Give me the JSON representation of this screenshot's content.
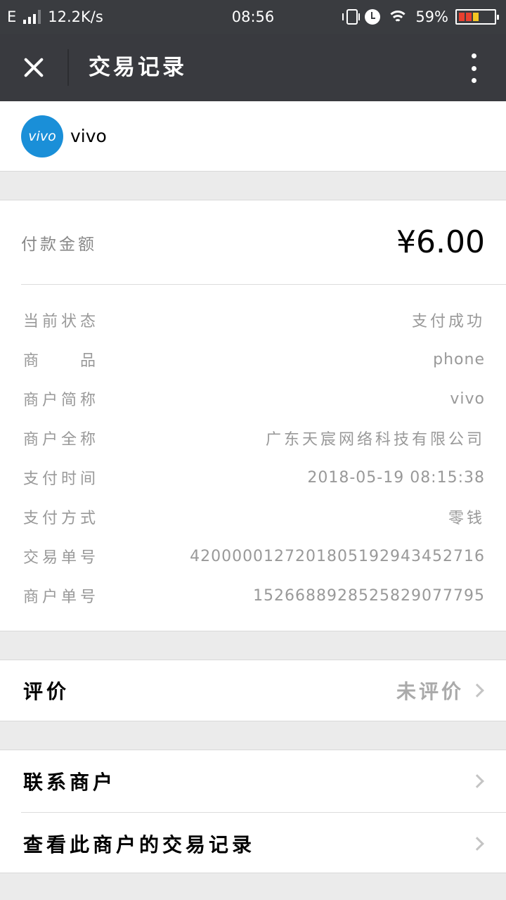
{
  "status_bar": {
    "network": "E",
    "speed": "12.2K/s",
    "time": "08:56",
    "battery": "59%",
    "icons": [
      "signal-icon",
      "vibrate-icon",
      "alarm-icon",
      "wifi-icon",
      "battery-icon"
    ]
  },
  "header": {
    "title": "交易记录",
    "close_icon": "close-icon",
    "more_icon": "more-vertical-icon"
  },
  "merchant": {
    "logo_text": "vivo",
    "name": "vivo",
    "logo_color": "#1a8fd8"
  },
  "payment": {
    "amount_label": "付款金额",
    "amount": "¥6.00"
  },
  "details": [
    {
      "label": "当前状态",
      "value": "支付成功"
    },
    {
      "label": "商　　品",
      "value": "phone"
    },
    {
      "label": "商户简称",
      "value": "vivo"
    },
    {
      "label": "商户全称",
      "value": "广东天宸网络科技有限公司"
    },
    {
      "label": "支付时间",
      "value": "2018-05-19 08:15:38"
    },
    {
      "label": "支付方式",
      "value": "零钱"
    },
    {
      "label": "交易单号",
      "value": "4200000127201805192943452716"
    },
    {
      "label": "商户单号",
      "value": "1526688928525829077795"
    }
  ],
  "review": {
    "label": "评价",
    "status": "未评价"
  },
  "links": {
    "contact_merchant": "联系商户",
    "view_merchant_records": "查看此商户的交易记录"
  },
  "colors": {
    "header_bg": "#393a3f",
    "page_bg": "#ebebeb",
    "muted_text": "#999999"
  }
}
